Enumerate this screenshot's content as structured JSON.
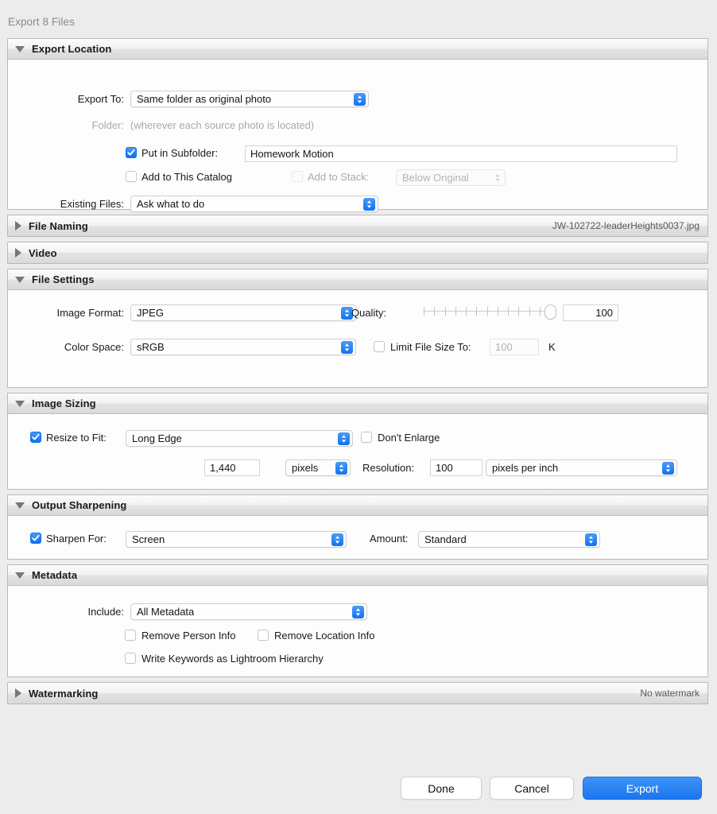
{
  "window": {
    "title": "Export 8 Files"
  },
  "colors": {
    "accent": "#1272ef",
    "window_bg": "#ececec",
    "panel_bg": "#fdfdfd",
    "header_text": "#1b1b1b",
    "title_text": "#8b8b8b",
    "disabled_text": "#b0b0b0"
  },
  "sections": {
    "export_location": {
      "title": "Export Location",
      "expanded": true,
      "export_to_label": "Export To:",
      "export_to_value": "Same folder as original photo",
      "folder_label": "Folder:",
      "folder_value": "(wherever each source photo is located)",
      "put_in_subfolder_label": "Put in Subfolder:",
      "put_in_subfolder_checked": true,
      "subfolder_value": "Homework Motion",
      "add_to_catalog_label": "Add to This Catalog",
      "add_to_catalog_checked": false,
      "add_to_stack_label": "Add to Stack:",
      "add_to_stack_checked": false,
      "add_to_stack_enabled": false,
      "add_to_stack_value": "Below Original",
      "existing_files_label": "Existing Files:",
      "existing_files_value": "Ask what to do"
    },
    "file_naming": {
      "title": "File Naming",
      "expanded": false,
      "summary": "JW-102722-leaderHeights0037.jpg"
    },
    "video": {
      "title": "Video",
      "expanded": false,
      "summary": ""
    },
    "file_settings": {
      "title": "File Settings",
      "expanded": true,
      "image_format_label": "Image Format:",
      "image_format_value": "JPEG",
      "quality_label": "Quality:",
      "quality_value": "100",
      "quality_min": 0,
      "quality_max": 100,
      "quality_ticks": 13,
      "color_space_label": "Color Space:",
      "color_space_value": "sRGB",
      "limit_file_size_label": "Limit File Size To:",
      "limit_file_size_checked": false,
      "limit_file_size_value": "100",
      "limit_file_size_unit": "K"
    },
    "image_sizing": {
      "title": "Image Sizing",
      "expanded": true,
      "resize_to_fit_label": "Resize to Fit:",
      "resize_to_fit_checked": true,
      "resize_to_fit_value": "Long Edge",
      "dont_enlarge_label": "Don't Enlarge",
      "dont_enlarge_checked": false,
      "size_value": "1,440",
      "size_unit_value": "pixels",
      "resolution_label": "Resolution:",
      "resolution_value": "100",
      "resolution_unit_value": "pixels per inch"
    },
    "output_sharpening": {
      "title": "Output Sharpening",
      "expanded": true,
      "sharpen_for_label": "Sharpen For:",
      "sharpen_for_checked": true,
      "sharpen_for_value": "Screen",
      "amount_label": "Amount:",
      "amount_value": "Standard"
    },
    "metadata": {
      "title": "Metadata",
      "expanded": true,
      "include_label": "Include:",
      "include_value": "All Metadata",
      "remove_person_label": "Remove Person Info",
      "remove_person_checked": false,
      "remove_location_label": "Remove Location Info",
      "remove_location_checked": false,
      "write_keywords_label": "Write Keywords as Lightroom Hierarchy",
      "write_keywords_checked": false
    },
    "watermarking": {
      "title": "Watermarking",
      "expanded": false,
      "summary": "No watermark"
    }
  },
  "footer": {
    "done_label": "Done",
    "cancel_label": "Cancel",
    "export_label": "Export"
  }
}
